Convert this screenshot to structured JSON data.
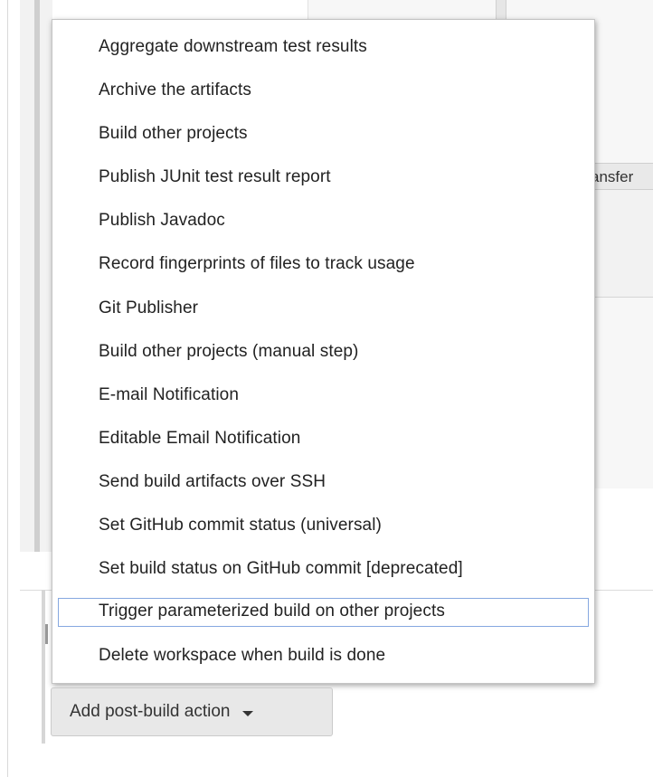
{
  "background": {
    "transfer_fragment": "ansfer"
  },
  "menu": {
    "items": [
      {
        "label": "Aggregate downstream test results"
      },
      {
        "label": "Archive the artifacts"
      },
      {
        "label": "Build other projects"
      },
      {
        "label": "Publish JUnit test result report"
      },
      {
        "label": "Publish Javadoc"
      },
      {
        "label": "Record fingerprints of files to track usage"
      },
      {
        "label": "Git Publisher"
      },
      {
        "label": "Build other projects (manual step)"
      },
      {
        "label": "E-mail Notification"
      },
      {
        "label": "Editable Email Notification"
      },
      {
        "label": "Send build artifacts over SSH"
      },
      {
        "label": "Set GitHub commit status (universal)"
      },
      {
        "label": "Set build status on GitHub commit [deprecated]"
      },
      {
        "label": "Trigger parameterized build on other projects"
      },
      {
        "label": "Delete workspace when build is done"
      }
    ],
    "focused_index": 13
  },
  "add_button": {
    "label": "Add post-build action",
    "icon": "caret-down-icon"
  }
}
